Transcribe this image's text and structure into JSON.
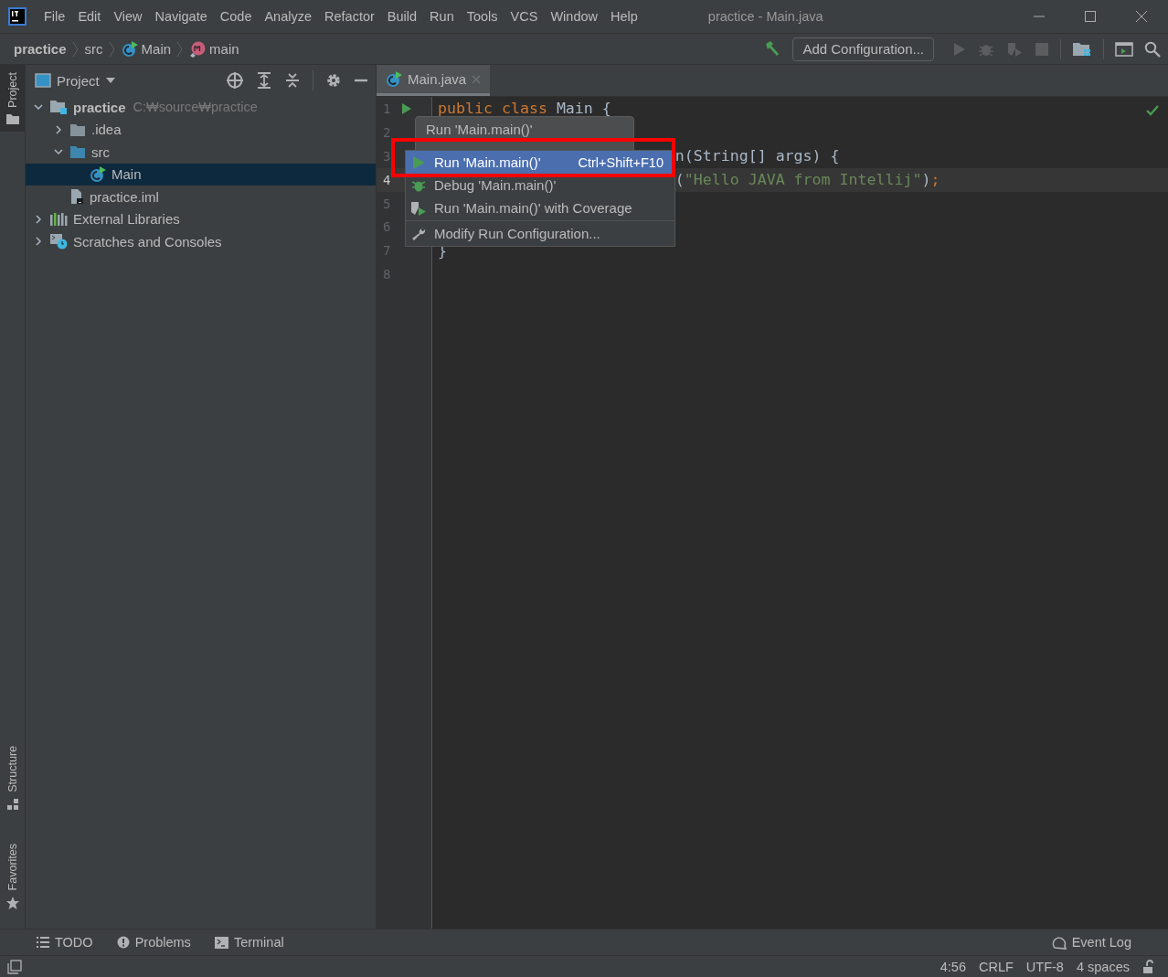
{
  "window": {
    "title": "practice - Main.java",
    "menu": [
      "File",
      "Edit",
      "View",
      "Navigate",
      "Code",
      "Analyze",
      "Refactor",
      "Build",
      "Run",
      "Tools",
      "VCS",
      "Window",
      "Help"
    ]
  },
  "navbar": {
    "breadcrumbs": [
      {
        "label": "practice",
        "kind": "project"
      },
      {
        "label": "src",
        "kind": "folder"
      },
      {
        "label": "Main",
        "kind": "class"
      },
      {
        "label": "main",
        "kind": "method"
      }
    ],
    "config_button": "Add Configuration..."
  },
  "left_stripe": {
    "top": [
      {
        "label": "Project",
        "selected": true
      }
    ],
    "bottom": [
      {
        "label": "Structure",
        "selected": false
      },
      {
        "label": "Favorites",
        "selected": false
      }
    ]
  },
  "project_panel": {
    "title": "Project",
    "tree": [
      {
        "label": "practice",
        "path": "C:₩source₩practice",
        "kind": "project",
        "expanded": true,
        "selected": false,
        "children": [
          {
            "label": ".idea",
            "kind": "folder",
            "expanded": false,
            "selected": false
          },
          {
            "label": "src",
            "kind": "source",
            "expanded": true,
            "selected": false,
            "children": [
              {
                "label": "Main",
                "kind": "class",
                "selected": true
              }
            ]
          },
          {
            "label": "practice.iml",
            "kind": "file",
            "selected": false
          }
        ]
      },
      {
        "label": "External Libraries",
        "kind": "libraries",
        "expanded": false,
        "selected": false
      },
      {
        "label": "Scratches and Consoles",
        "kind": "scratches",
        "expanded": false,
        "selected": false
      }
    ]
  },
  "editor": {
    "tabs": [
      {
        "label": "Main.java",
        "selected": true
      }
    ],
    "lines": [
      {
        "number": "1",
        "run": true,
        "current": false,
        "kind": "full",
        "tokens": [
          {
            "text": "public class ",
            "color": "#cc7832"
          },
          {
            "text": "Main {",
            "color": "#a9b7c6"
          }
        ]
      },
      {
        "number": "2",
        "run": false,
        "current": false,
        "kind": "covered"
      },
      {
        "number": "3",
        "run": false,
        "current": false,
        "kind": "partly_covered",
        "tokens": [
          {
            "text": "n(String[] args) {",
            "color": "#a9b7c6"
          }
        ]
      },
      {
        "number": "4",
        "run": false,
        "current": true,
        "kind": "partly_covered",
        "tokens": [
          {
            "text": "(",
            "color": "#a9b7c6"
          },
          {
            "text": "\"Hello JAVA from Intellij\"",
            "color": "#6a8759"
          },
          {
            "text": ")",
            "color": "#a9b7c6"
          },
          {
            "text": ";",
            "color": "#cc7832"
          }
        ]
      },
      {
        "number": "5",
        "run": false,
        "current": false,
        "kind": "covered"
      },
      {
        "number": "6",
        "run": false,
        "current": false,
        "kind": "covered"
      },
      {
        "number": "7",
        "run": false,
        "current": false,
        "kind": "full",
        "tokens": [
          {
            "text": "}",
            "color": "#a9b7c6"
          }
        ]
      },
      {
        "number": "8",
        "run": false,
        "current": false,
        "kind": "empty"
      }
    ],
    "back_popup": {
      "title": "Run 'Main.main()'"
    },
    "menu": [
      {
        "label": "Run 'Main.main()'",
        "shortcut": "Ctrl+Shift+F10",
        "kind": "run",
        "selected": true
      },
      {
        "label": "Debug 'Main.main()'",
        "kind": "debug",
        "selected": false
      },
      {
        "label": "Run 'Main.main()' with Coverage",
        "kind": "coverage",
        "selected": false
      },
      {
        "label": "Modify Run Configuration...",
        "kind": "modify",
        "selected": false
      }
    ],
    "annotation": {
      "kind": "frame"
    }
  },
  "tool_tabs": [
    {
      "label": "TODO",
      "kind": "todo"
    },
    {
      "label": "Problems",
      "kind": "problems"
    },
    {
      "label": "Terminal",
      "kind": "terminal"
    },
    {
      "label": "Event Log",
      "kind": "eventlog"
    }
  ],
  "status_bar": [
    "4:56",
    "CRLF",
    "UTF-8",
    "4 spaces"
  ]
}
